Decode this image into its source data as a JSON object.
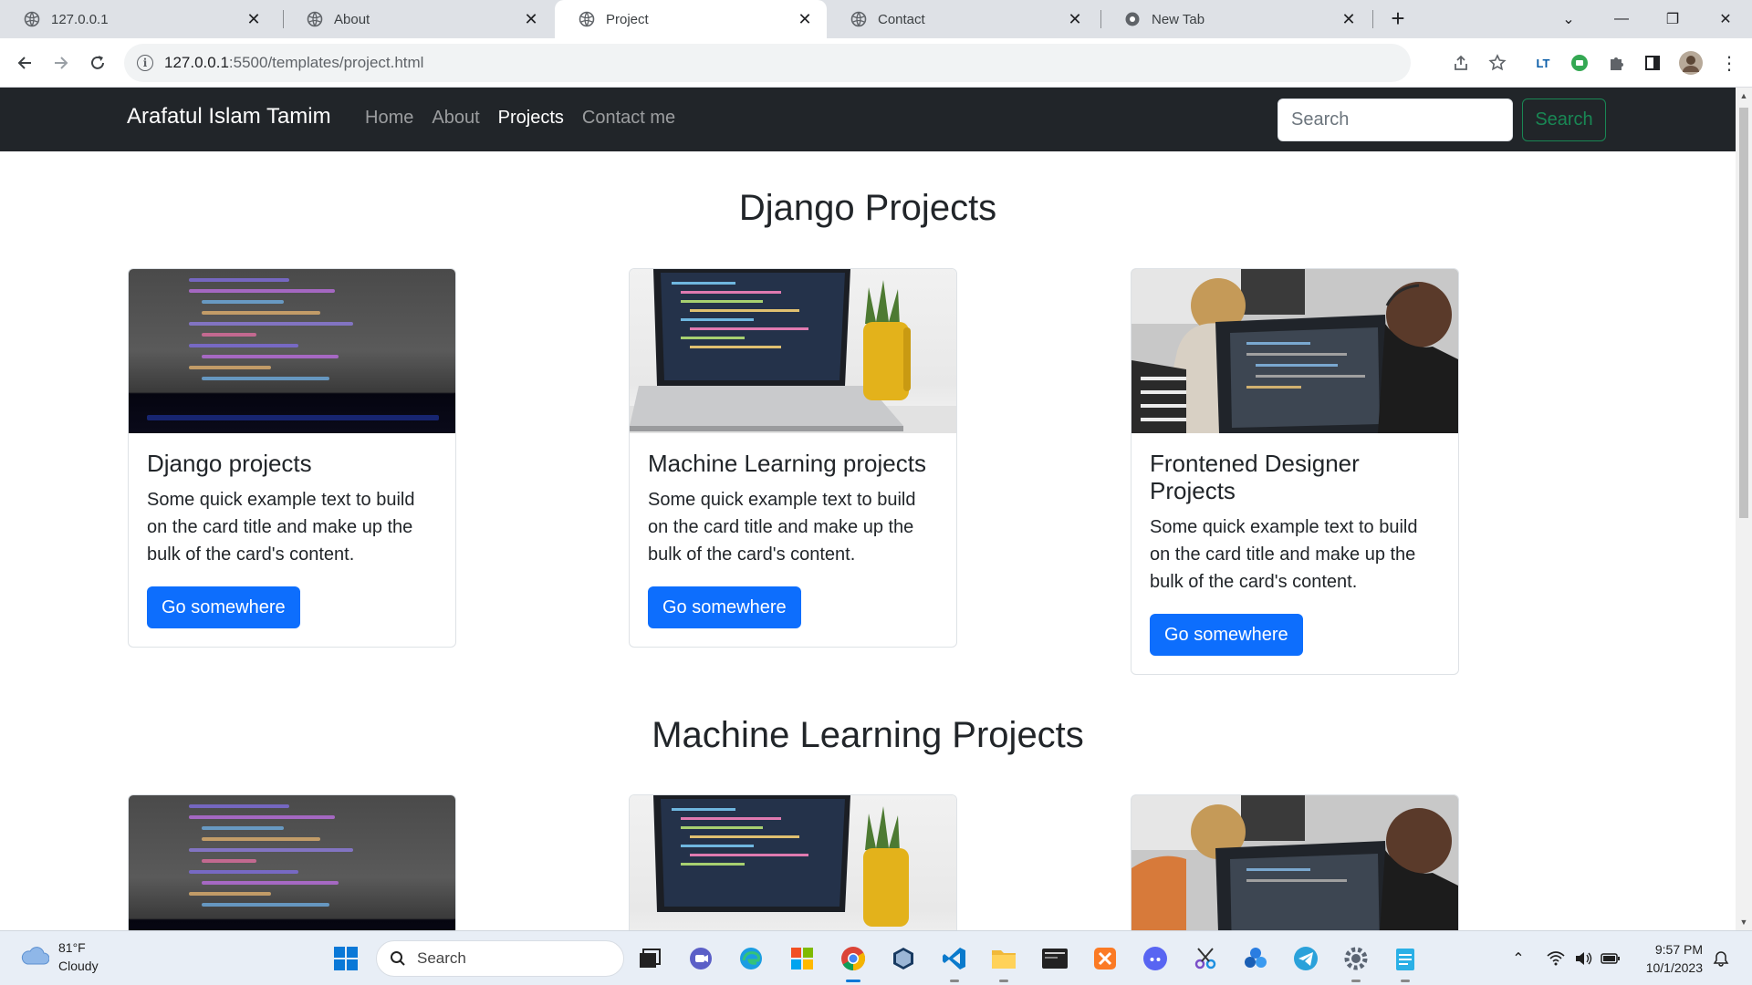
{
  "browser": {
    "tabs": [
      {
        "title": "127.0.0.1",
        "active": false
      },
      {
        "title": "About",
        "active": false
      },
      {
        "title": "Project",
        "active": true
      },
      {
        "title": "Contact",
        "active": false
      },
      {
        "title": "New Tab",
        "active": false
      }
    ],
    "url_host": "127.0.0.1",
    "url_path": ":5500/templates/project.html"
  },
  "site": {
    "brand": "Arafatul Islam Tamim",
    "nav": [
      "Home",
      "About",
      "Projects",
      "Contact me"
    ],
    "active_nav": "Projects",
    "search_placeholder": "Search",
    "search_button": "Search"
  },
  "sections": [
    {
      "title": "Django Projects",
      "cards": [
        {
          "title": "Django projects",
          "text": "Some quick example text to build on the card title and make up the bulk of the card's content.",
          "button": "Go somewhere",
          "image": "code-screen"
        },
        {
          "title": "Machine Learning projects",
          "text": "Some quick example text to build on the card title and make up the bulk of the card's content.",
          "button": "Go somewhere",
          "image": "laptop-desk"
        },
        {
          "title": "Frontened Designer Projects",
          "text": "Some quick example text to build on the card title and make up the bulk of the card's content.",
          "button": "Go somewhere",
          "image": "people-computer"
        }
      ]
    },
    {
      "title": "Machine Learning Projects",
      "cards": [
        {
          "image": "code-screen"
        },
        {
          "image": "laptop-desk"
        },
        {
          "image": "people-computer"
        }
      ]
    }
  ],
  "taskbar": {
    "weather_temp": "81°F",
    "weather_desc": "Cloudy",
    "search_label": "Search",
    "time": "9:57 PM",
    "date": "10/1/2023"
  }
}
